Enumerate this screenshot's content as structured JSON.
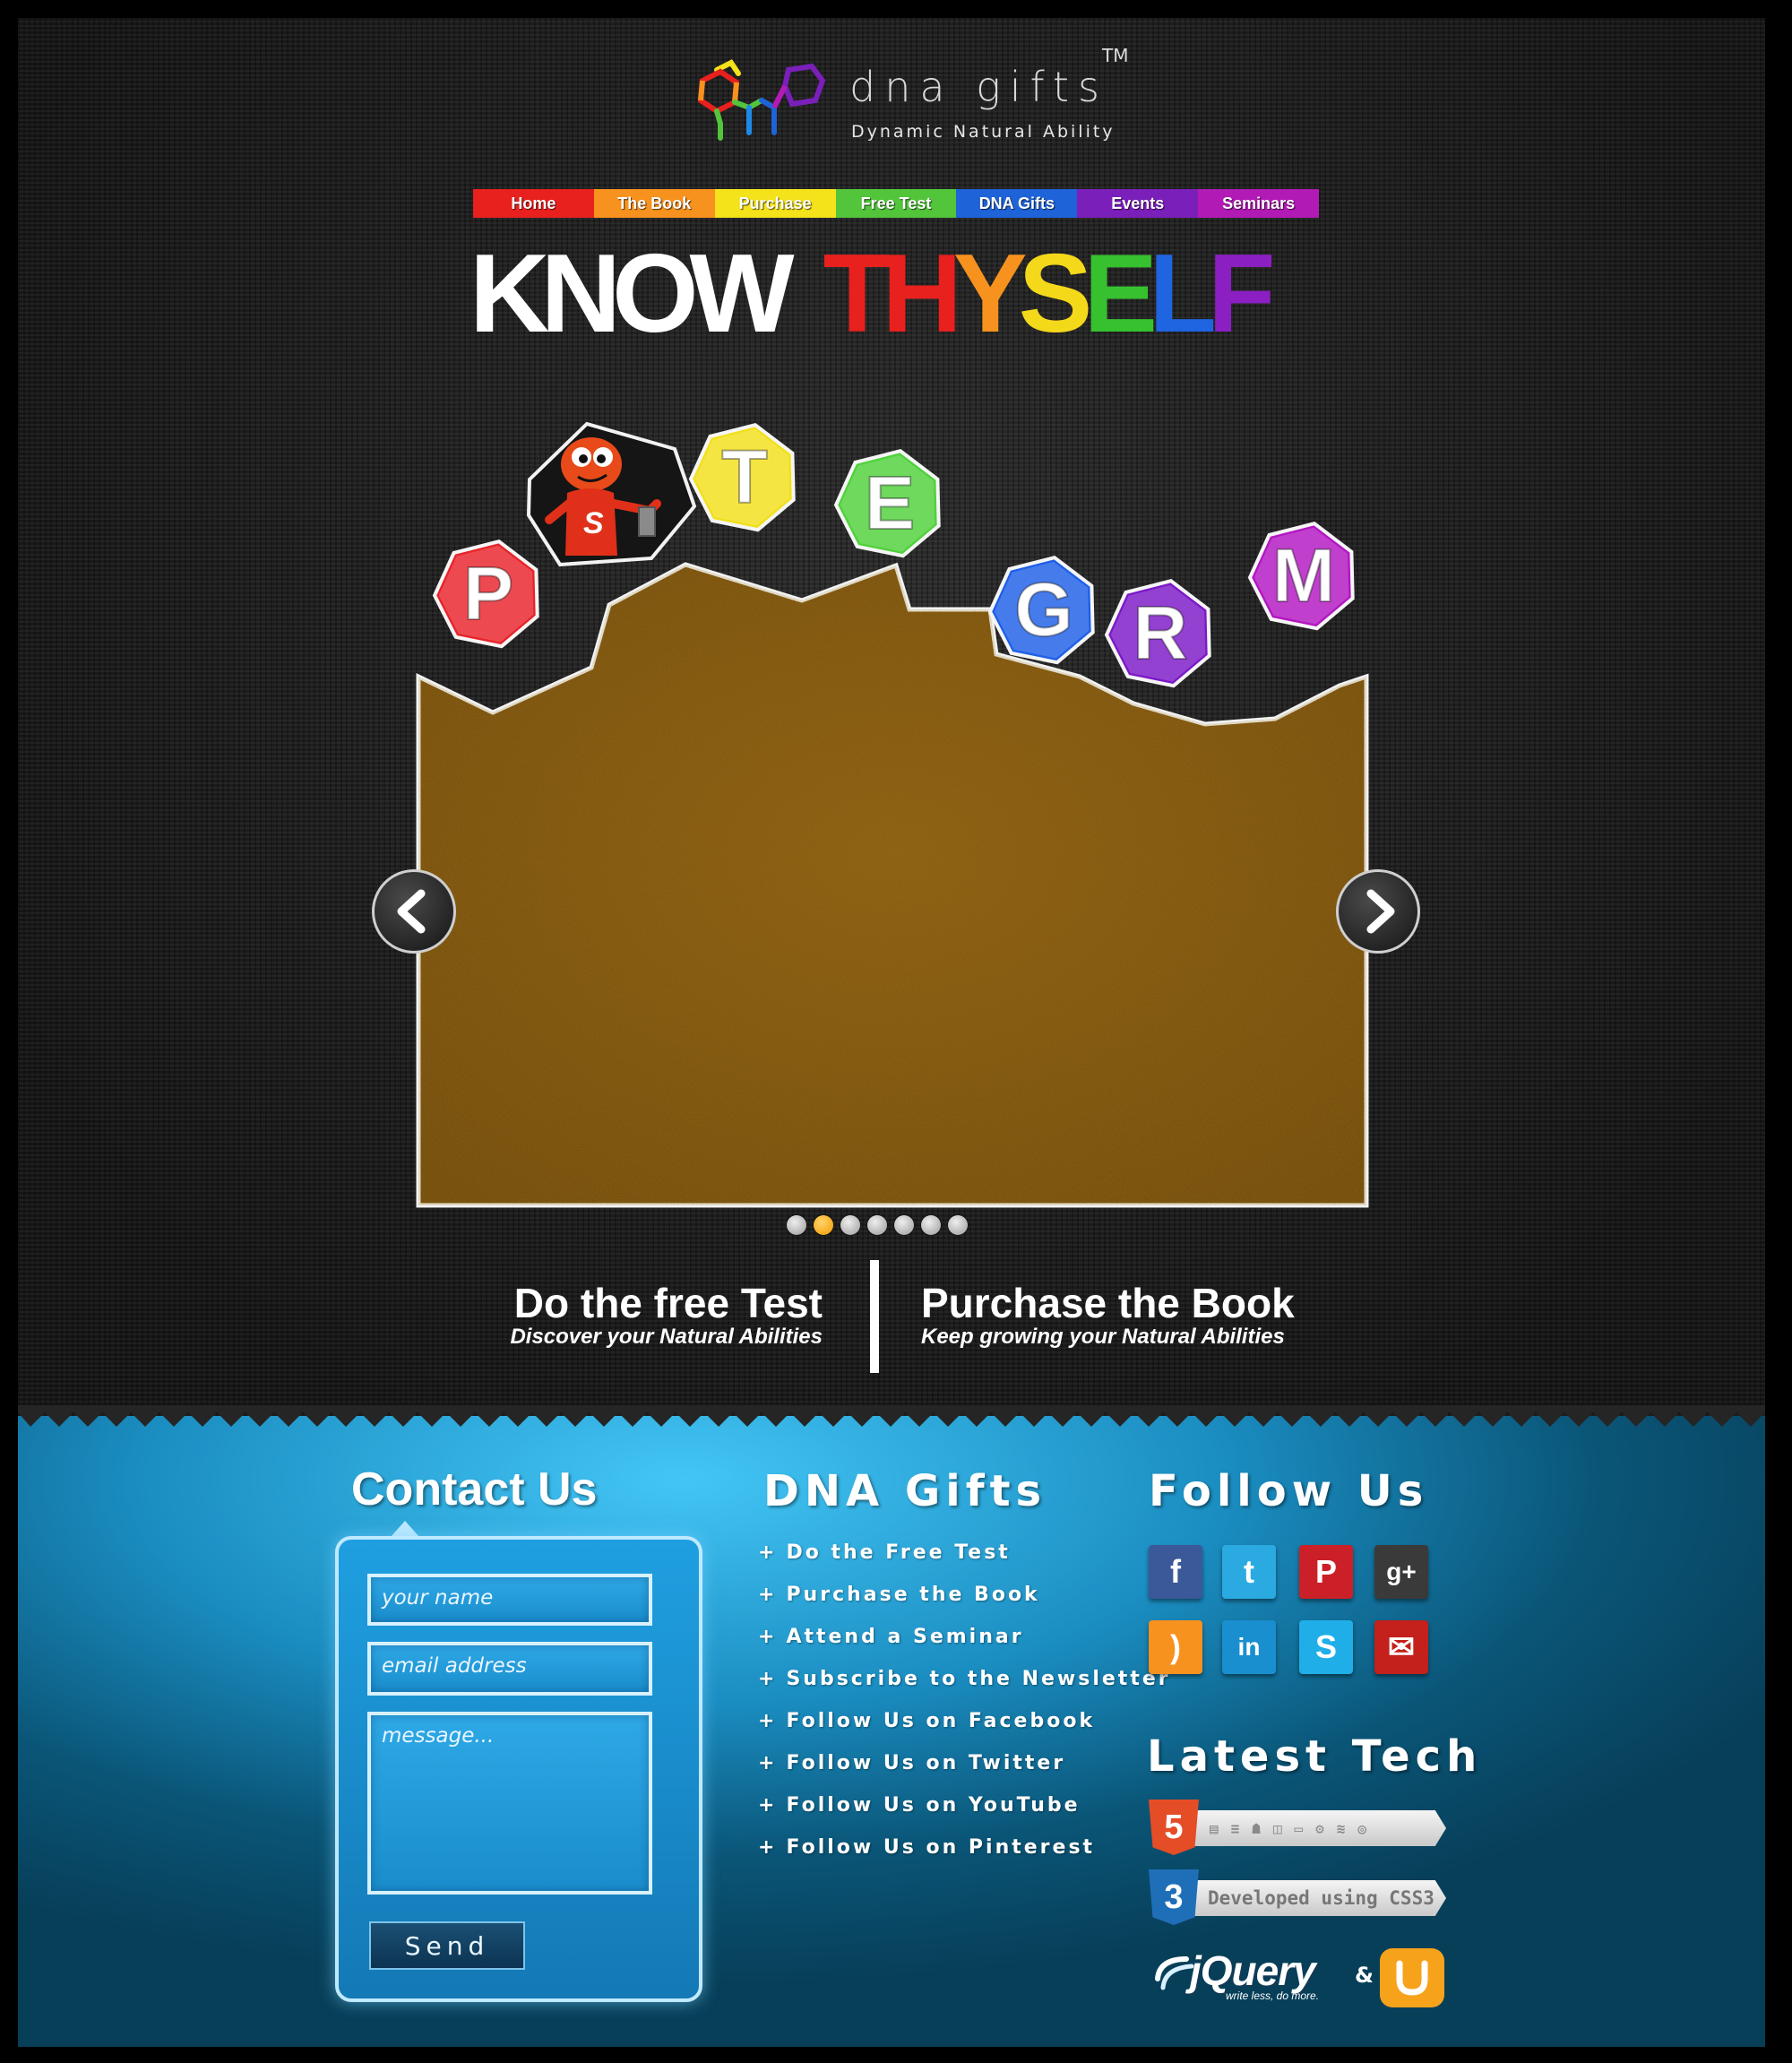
{
  "brand": {
    "name": "dna gifts",
    "tagline": "Dynamic Natural Ability",
    "trademark": "TM"
  },
  "nav": {
    "items": [
      {
        "label": "Home",
        "color": "#e8201e"
      },
      {
        "label": "The Book",
        "color": "#f7921e"
      },
      {
        "label": "Purchase",
        "color": "#f4e21a"
      },
      {
        "label": "Free Test",
        "color": "#52c53b"
      },
      {
        "label": "DNA Gifts",
        "color": "#1e63d8"
      },
      {
        "label": "Events",
        "color": "#7a1fba"
      },
      {
        "label": "Seminars",
        "color": "#b21ab6"
      }
    ]
  },
  "headline": {
    "word1": "KNOW",
    "word2": [
      {
        "char": "T",
        "color": "#e8201e"
      },
      {
        "char": "H",
        "color": "#e8201e"
      },
      {
        "char": "Y",
        "color": "#f7921e"
      },
      {
        "char": "S",
        "color": "#f4d81a"
      },
      {
        "char": "E",
        "color": "#37c12f"
      },
      {
        "char": "L",
        "color": "#1f64e0"
      },
      {
        "char": "F",
        "color": "#8b1fc1"
      }
    ]
  },
  "slider": {
    "letters": [
      {
        "char": "P",
        "color": "#e8232a"
      },
      {
        "char": "T",
        "color": "#f2e01a"
      },
      {
        "char": "E",
        "color": "#4fd13a"
      },
      {
        "char": "G",
        "color": "#1e5fe8"
      },
      {
        "char": "R",
        "color": "#7c18c7"
      },
      {
        "char": "M",
        "color": "#b215c2"
      }
    ],
    "mascot_letter": "S",
    "slide_count": 7,
    "active_slide": 2
  },
  "cta": {
    "left_title": "Do the free Test",
    "left_sub": "Discover your Natural Abilities",
    "right_title": "Purchase the Book",
    "right_sub": "Keep growing your Natural Abilities"
  },
  "contact": {
    "title": "Contact Us",
    "name_placeholder": "your name",
    "email_placeholder": "email address",
    "message_placeholder": "message...",
    "send_label": "Send"
  },
  "gifts": {
    "title": "DNA Gifts",
    "links": [
      "Do the Free Test",
      "Purchase the Book",
      "Attend a Seminar",
      "Subscribe to the Newsletter",
      "Follow Us on Facebook",
      "Follow Us on Twitter",
      "Follow Us on YouTube",
      "Follow Us on Pinterest"
    ]
  },
  "follow": {
    "title": "Follow Us",
    "icons": [
      {
        "name": "facebook-icon",
        "glyph": "f",
        "color": "#3b5998"
      },
      {
        "name": "twitter-icon",
        "glyph": "t",
        "color": "#2ba9e1"
      },
      {
        "name": "pinterest-icon",
        "glyph": "P",
        "color": "#cb2027"
      },
      {
        "name": "google-plus-icon",
        "glyph": "g+",
        "color": "#3a3a3a"
      },
      {
        "name": "rss-icon",
        "glyph": ")",
        "color": "#f7921e"
      },
      {
        "name": "linkedin-icon",
        "glyph": "in",
        "color": "#1a8fd0"
      },
      {
        "name": "skype-icon",
        "glyph": "S",
        "color": "#1faee8"
      },
      {
        "name": "email-icon",
        "glyph": "✉",
        "color": "#c4201c"
      }
    ]
  },
  "tech": {
    "title": "Latest Tech",
    "html5_label": "5",
    "css3_badge": "Developed using CSS3",
    "css3_label": "3",
    "jquery_label": "jQuery",
    "jquery_tagline": "write less, do more.",
    "ampersand": "&"
  }
}
